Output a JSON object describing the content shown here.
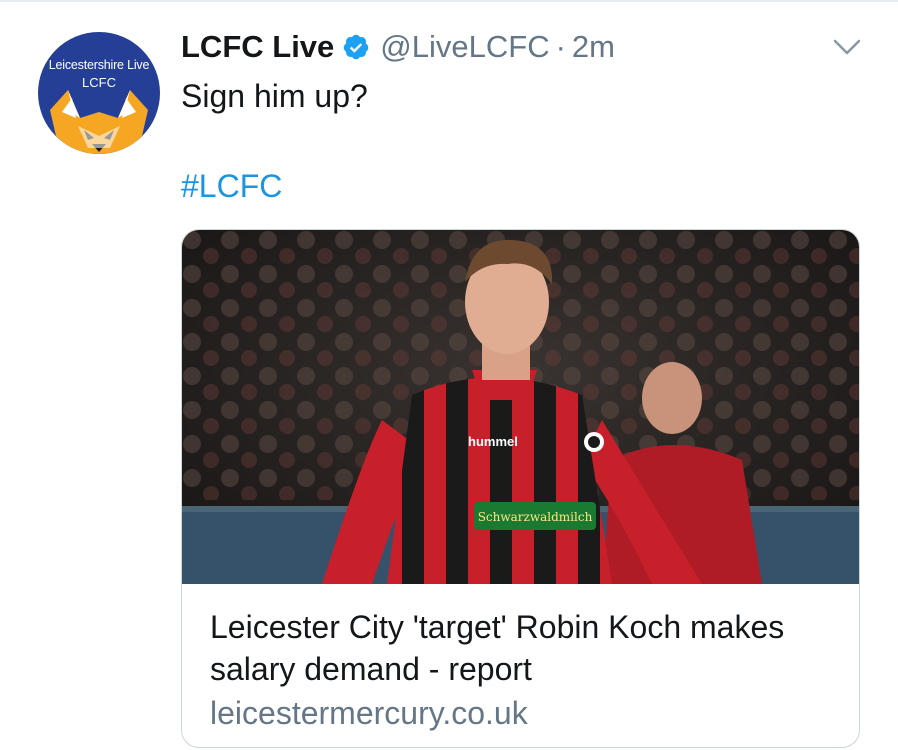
{
  "avatar": {
    "line1": "Leicestershire Live",
    "line2": "LCFC",
    "background": "#243f95",
    "fox_color": "#f5a623"
  },
  "tweet": {
    "display_name": "LCFC Live",
    "verified": true,
    "handle": "@LiveLCFC",
    "separator": "·",
    "time": "2m",
    "text": "Sign him up?",
    "hashtag": "#LCFC"
  },
  "card": {
    "title": "Leicester City 'target' Robin Koch makes salary demand - report",
    "domain": "leicestermercury.co.uk",
    "jersey_brand": "hummel",
    "jersey_sponsor": "Schwarzwaldmilch"
  },
  "icons": {
    "verified": "verified-badge-icon",
    "menu": "chevron-down-icon"
  },
  "colors": {
    "link": "#1b95e0",
    "secondary_text": "#657786",
    "verified": "#1da1f2"
  }
}
